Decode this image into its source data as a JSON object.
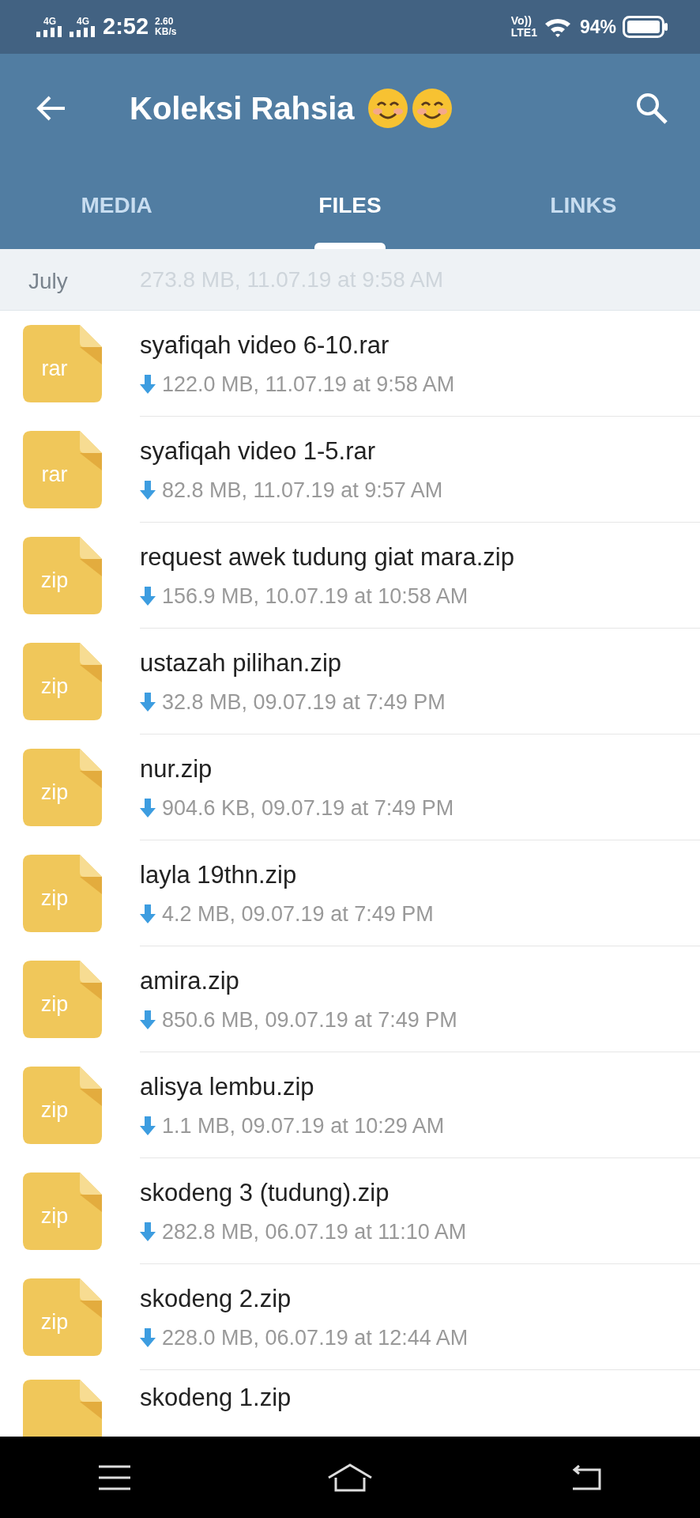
{
  "status_bar": {
    "signal_1": "4G",
    "signal_2": "4G",
    "time": "2:52",
    "speed": "2.60",
    "speed_unit": "KB/s",
    "volte": "Vo))",
    "lte": "LTE1",
    "battery": "94%"
  },
  "header": {
    "title": "Koleksi Rahsia"
  },
  "tabs": [
    {
      "label": "MEDIA",
      "selected": false
    },
    {
      "label": "FILES",
      "selected": true
    },
    {
      "label": "LINKS",
      "selected": false
    }
  ],
  "section": {
    "label": "July",
    "faded_meta": "273.8 MB, 11.07.19 at 9:58 AM"
  },
  "files": [
    {
      "ext": "rar",
      "name": "syafiqah video 6-10.rar",
      "meta": "122.0 MB, 11.07.19 at 9:58 AM"
    },
    {
      "ext": "rar",
      "name": "syafiqah video 1-5.rar",
      "meta": "82.8 MB, 11.07.19 at 9:57 AM"
    },
    {
      "ext": "zip",
      "name": "request awek tudung giat mara.zip",
      "meta": "156.9 MB, 10.07.19 at 10:58 AM"
    },
    {
      "ext": "zip",
      "name": "ustazah pilihan.zip",
      "meta": "32.8 MB, 09.07.19 at 7:49 PM"
    },
    {
      "ext": "zip",
      "name": "nur.zip",
      "meta": "904.6 KB, 09.07.19 at 7:49 PM"
    },
    {
      "ext": "zip",
      "name": "layla 19thn.zip",
      "meta": "4.2 MB, 09.07.19 at 7:49 PM"
    },
    {
      "ext": "zip",
      "name": "amira.zip",
      "meta": "850.6 MB, 09.07.19 at 7:49 PM"
    },
    {
      "ext": "zip",
      "name": "alisya lembu.zip",
      "meta": "1.1 MB, 09.07.19 at 10:29 AM"
    },
    {
      "ext": "zip",
      "name": "skodeng 3 (tudung).zip",
      "meta": "282.8 MB, 06.07.19 at 11:10 AM"
    },
    {
      "ext": "zip",
      "name": "skodeng 2.zip",
      "meta": "228.0 MB, 06.07.19 at 12:44 AM"
    },
    {
      "name": "skodeng 1.zip"
    }
  ]
}
